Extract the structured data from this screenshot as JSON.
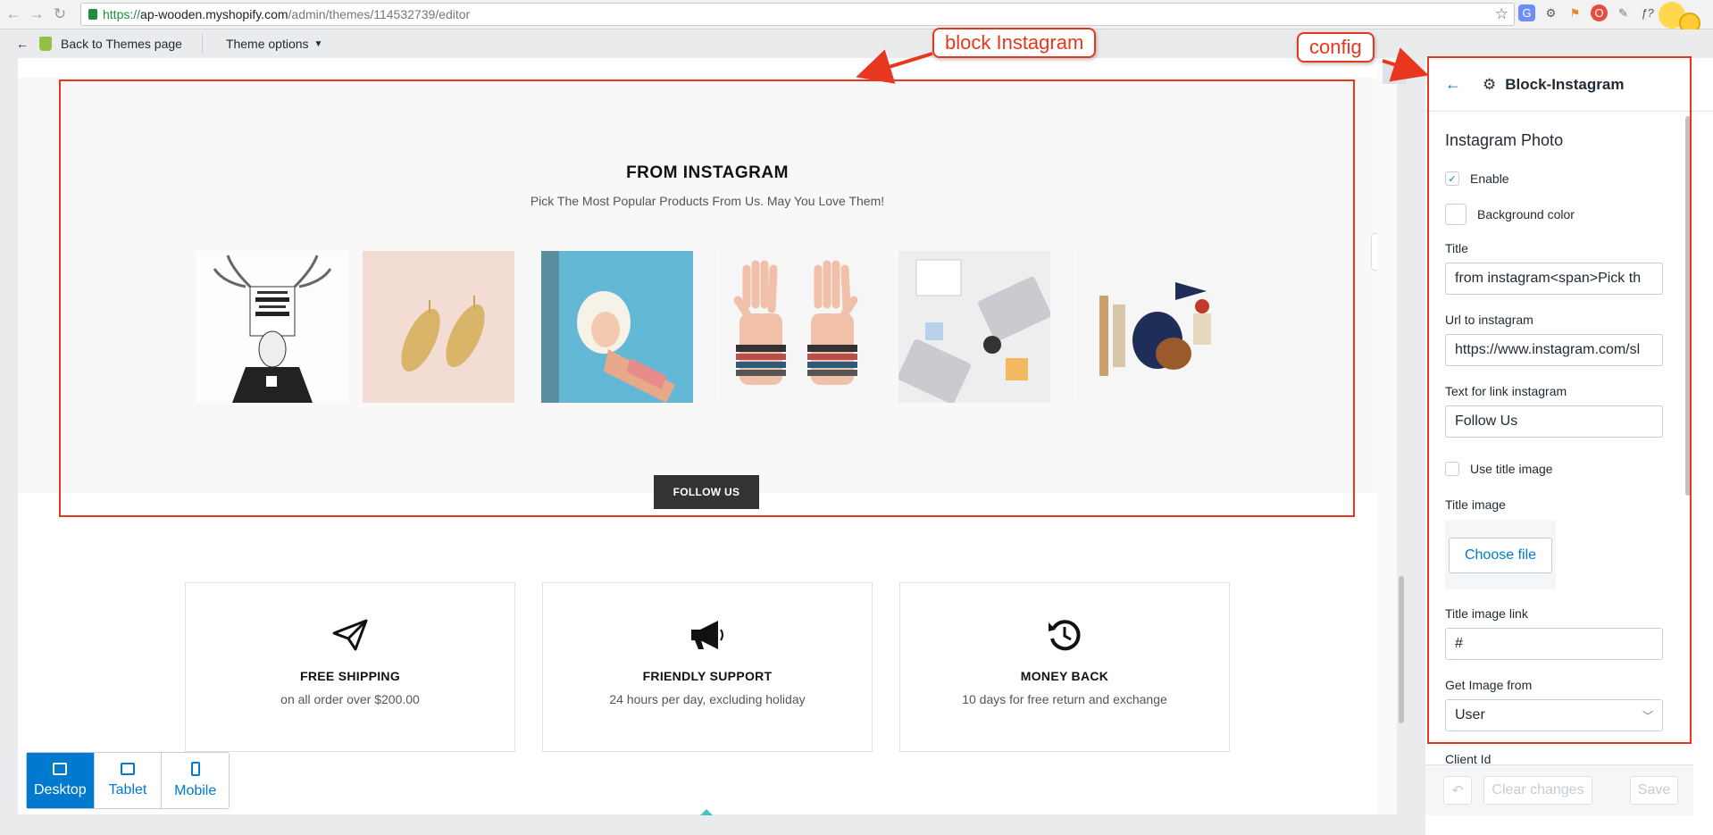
{
  "browser": {
    "url_scheme": "https://",
    "url_host": "ap-wooden.myshopify.com",
    "url_path": "/admin/themes/114532739/editor"
  },
  "topbar": {
    "back_label": "Back to Themes page",
    "theme_options_label": "Theme options"
  },
  "section": {
    "title": "FROM INSTAGRAM",
    "subtitle": "Pick The Most Popular Products From Us. May You Love Them!",
    "follow_label": "FOLLOW US",
    "photos": [
      "deer-skull-poster",
      "gold-earrings",
      "girl-on-blanket",
      "bracelet-hands",
      "desk-laptops",
      "product-kit"
    ]
  },
  "features": [
    {
      "icon": "paper-plane-icon",
      "title": "FREE SHIPPING",
      "text": "on all order over $200.00"
    },
    {
      "icon": "megaphone-icon",
      "title": "FRIENDLY SUPPORT",
      "text": "24 hours per day, excluding holiday"
    },
    {
      "icon": "clock-back-icon",
      "title": "MONEY BACK",
      "text": "10 days for free return and exchange"
    }
  ],
  "devices": {
    "desktop": "Desktop",
    "tablet": "Tablet",
    "mobile": "Mobile",
    "active": "desktop"
  },
  "sidebar": {
    "title": "Block-Instagram",
    "heading": "Instagram Photo",
    "enable_label": "Enable",
    "enable_checked": true,
    "bg_color_label": "Background color",
    "title_label": "Title",
    "title_value": "from instagram<span>Pick th",
    "url_label": "Url to instagram",
    "url_value": "https://www.instagram.com/sl",
    "link_text_label": "Text for link instagram",
    "link_text_value": "Follow Us",
    "use_title_image_label": "Use title image",
    "use_title_image_checked": false,
    "title_image_label": "Title image",
    "choose_file_label": "Choose file",
    "title_image_link_label": "Title image link",
    "title_image_link_value": "#",
    "get_image_label": "Get Image from",
    "get_image_value": "User",
    "client_id_label": "Client Id"
  },
  "footer": {
    "clear_label": "Clear changes",
    "save_label": "Save"
  },
  "annotations": {
    "block_label": "block Instagram",
    "config_label": "config",
    "color": "#e8371f"
  },
  "colors": {
    "accent": "#007ace",
    "follow_bg": "#333333"
  }
}
